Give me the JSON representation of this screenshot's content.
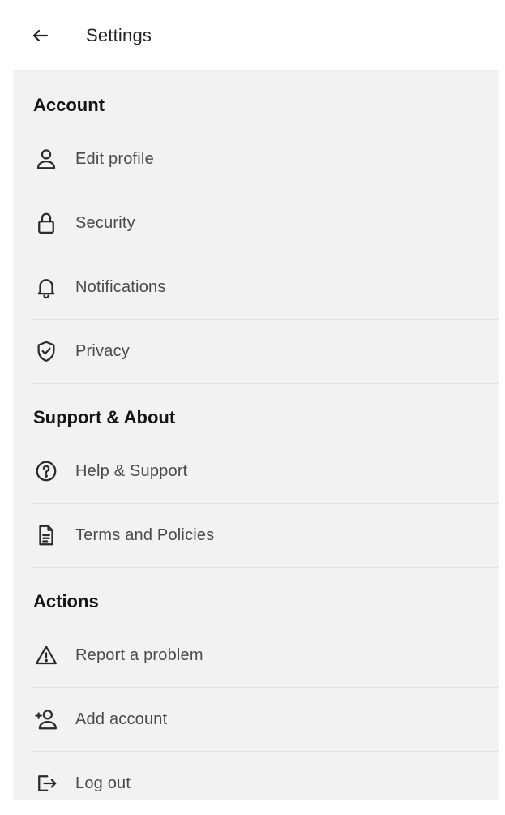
{
  "header": {
    "title": "Settings",
    "back_icon": "arrow-left-icon"
  },
  "sections": [
    {
      "title": "Account",
      "items": [
        {
          "label": "Edit profile",
          "icon": "user-icon"
        },
        {
          "label": "Security",
          "icon": "lock-icon"
        },
        {
          "label": "Notifications",
          "icon": "bell-icon"
        },
        {
          "label": "Privacy",
          "icon": "shield-check-icon"
        }
      ]
    },
    {
      "title": "Support & About",
      "items": [
        {
          "label": "Help & Support",
          "icon": "question-circle-icon"
        },
        {
          "label": "Terms and Policies",
          "icon": "document-icon"
        }
      ]
    },
    {
      "title": "Actions",
      "items": [
        {
          "label": "Report a problem",
          "icon": "warning-icon"
        },
        {
          "label": "Add account",
          "icon": "user-plus-icon"
        },
        {
          "label": "Log out",
          "icon": "logout-icon"
        }
      ]
    }
  ],
  "colors": {
    "header_bg": "#ffffff",
    "panel_bg": "#f2f2f2",
    "divider": "#e2e2e2",
    "label_text": "#4a4a4a",
    "section_text": "#141414"
  }
}
